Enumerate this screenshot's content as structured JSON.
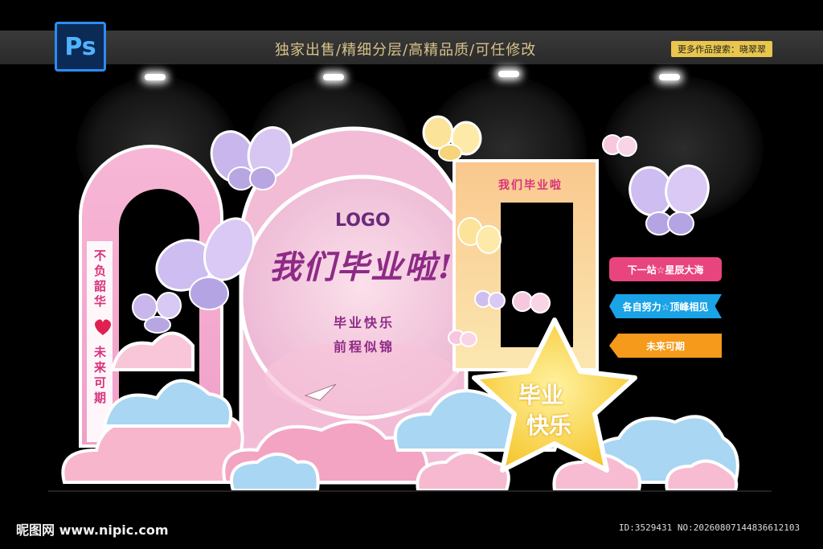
{
  "header": {
    "app_badge": "Ps",
    "headline": "独家出售/精细分层/高精品质/可任修改",
    "search_tag": "更多作品搜索：晓翠翠"
  },
  "stage": {
    "logo": "LOGO",
    "main_title": "我们毕业啦!",
    "sub_line1": "毕业快乐",
    "sub_line2": "前程似锦",
    "left_arch_text1": "不负韶华",
    "left_arch_text2": "未来可期",
    "frame_title": "我们毕业啦",
    "star_line1": "毕业",
    "star_line2": "快乐",
    "signs": [
      "下一站☆星辰大海",
      "各自努力☆顶峰相见",
      "未来可期"
    ]
  },
  "footer": {
    "site": "昵图网 www.nipic.com",
    "id": "ID:3529431 NO:20260807144836612103"
  },
  "colors": {
    "sign1": "#e8457e",
    "sign2": "#1aa3e6",
    "sign3": "#f59a1b",
    "arch_pink": "#f3a9cd",
    "frame_yellow": "#f8d58a",
    "title_purple": "#8e2a86"
  }
}
